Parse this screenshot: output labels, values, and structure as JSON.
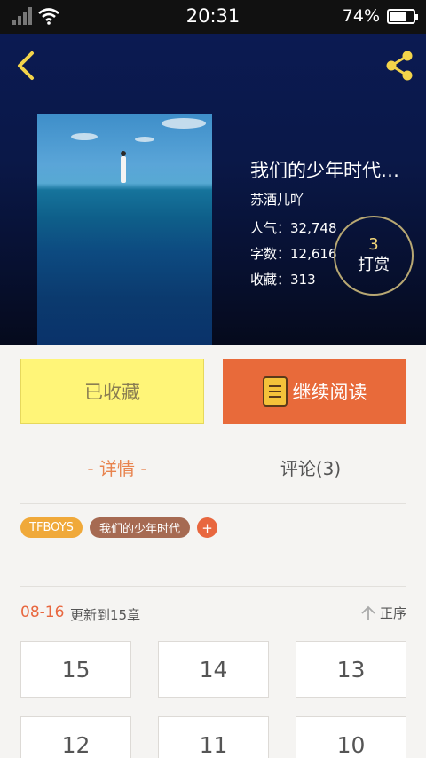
{
  "status_bar": {
    "time": "20:31",
    "battery": "74%",
    "battery_level": 0.74
  },
  "hero": {
    "title": "我们的少年时代…",
    "author": "苏酒儿吖",
    "popularity_label": "人气：",
    "popularity_value": "32,748",
    "wordcount_label": "字数：",
    "wordcount_value": "12,616",
    "favorites_label": "收藏：",
    "favorites_value": "313",
    "tip_count": "3",
    "tip_label": "打赏"
  },
  "actions": {
    "collected_label": "已收藏",
    "read_label": "继续阅读"
  },
  "tabs": {
    "detail_label": "- 详情 -",
    "comments_label": "评论(3)"
  },
  "tags": [
    {
      "label": "TFBOYS"
    },
    {
      "label": "我们的少年时代"
    },
    {
      "label": "+"
    }
  ],
  "update": {
    "date": "08-16",
    "text": "更新到15章",
    "sort_label": "正序"
  },
  "chapters": [
    "15",
    "14",
    "13",
    "12",
    "11",
    "10"
  ],
  "colors": {
    "accent": "#e8673f",
    "collected_bg": "#fff578",
    "read_bg": "#e86a3a",
    "hero_bg": "#0a1848"
  },
  "icons": {
    "back": "chevron-left-icon",
    "share": "share-icon",
    "sort": "arrow-up-icon",
    "book": "book-icon"
  }
}
